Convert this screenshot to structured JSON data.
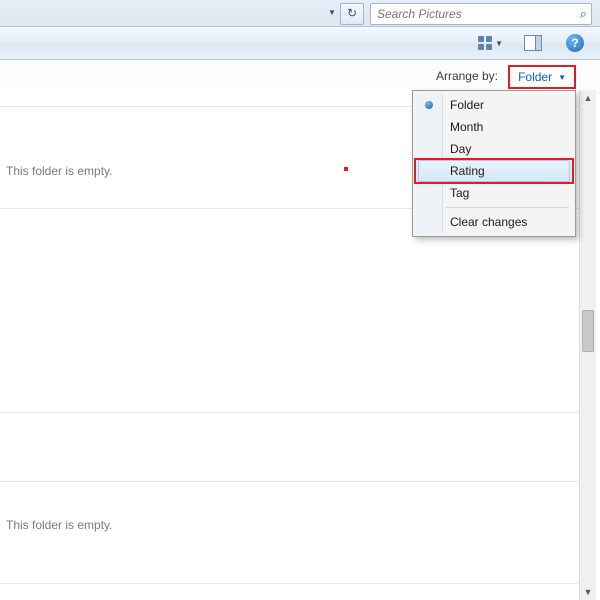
{
  "search": {
    "placeholder": "Search Pictures"
  },
  "arrange": {
    "label": "Arrange by:",
    "value": "Folder"
  },
  "dropdown": {
    "items": [
      {
        "label": "Folder",
        "selected": true,
        "highlight": false
      },
      {
        "label": "Month",
        "selected": false,
        "highlight": false
      },
      {
        "label": "Day",
        "selected": false,
        "highlight": false
      },
      {
        "label": "Rating",
        "selected": false,
        "highlight": true
      },
      {
        "label": "Tag",
        "selected": false,
        "highlight": false
      }
    ],
    "clear": "Clear changes"
  },
  "content": {
    "empty_message": "This folder is empty."
  }
}
